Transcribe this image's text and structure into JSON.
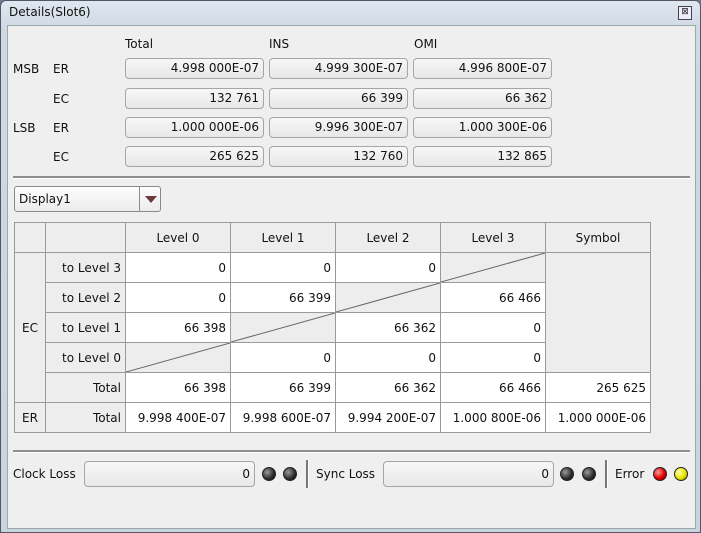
{
  "window": {
    "title": "Details(Slot6)",
    "close_glyph": "⊠"
  },
  "summary": {
    "col_headers": [
      "Total",
      "INS",
      "OMI"
    ],
    "msb_label": "MSB",
    "lsb_label": "LSB",
    "er_label": "ER",
    "ec_label": "EC",
    "msb_er": [
      "4.998 000E-07",
      "4.999 300E-07",
      "4.996 800E-07"
    ],
    "msb_ec": [
      "132 761",
      "66 399",
      "66 362"
    ],
    "lsb_er": [
      "1.000 000E-06",
      "9.996 300E-07",
      "1.000 300E-06"
    ],
    "lsb_ec": [
      "265 625",
      "132 760",
      "132 865"
    ]
  },
  "display_select": {
    "value": "Display1"
  },
  "matrix": {
    "headers": [
      "Level 0",
      "Level 1",
      "Level 2",
      "Level 3",
      "Symbol"
    ],
    "ec_label": "EC",
    "er_label": "ER",
    "rows": [
      {
        "label": "to Level 3",
        "cells": [
          "0",
          "0",
          "0"
        ]
      },
      {
        "label": "to Level 2",
        "cells": [
          "0",
          "66 399",
          "66 466"
        ]
      },
      {
        "label": "to Level 1",
        "cells": [
          "66 398",
          "66 362",
          "0"
        ]
      },
      {
        "label": "to Level 0",
        "cells": [
          "0",
          "0",
          "0"
        ]
      }
    ],
    "total_label": "Total",
    "ec_total": [
      "66 398",
      "66 399",
      "66 362",
      "66 466",
      "265 625"
    ],
    "er_total": [
      "9.998 400E-07",
      "9.998 600E-07",
      "9.994 200E-07",
      "1.000 800E-06",
      "1.000 000E-06"
    ]
  },
  "status": {
    "clock_loss_label": "Clock Loss",
    "clock_loss_value": "0",
    "sync_loss_label": "Sync Loss",
    "sync_loss_value": "0",
    "error_label": "Error"
  },
  "colors": {
    "error_led": "#e00000",
    "warn_led": "#e6e600",
    "off_led": "#2a2a2a"
  }
}
